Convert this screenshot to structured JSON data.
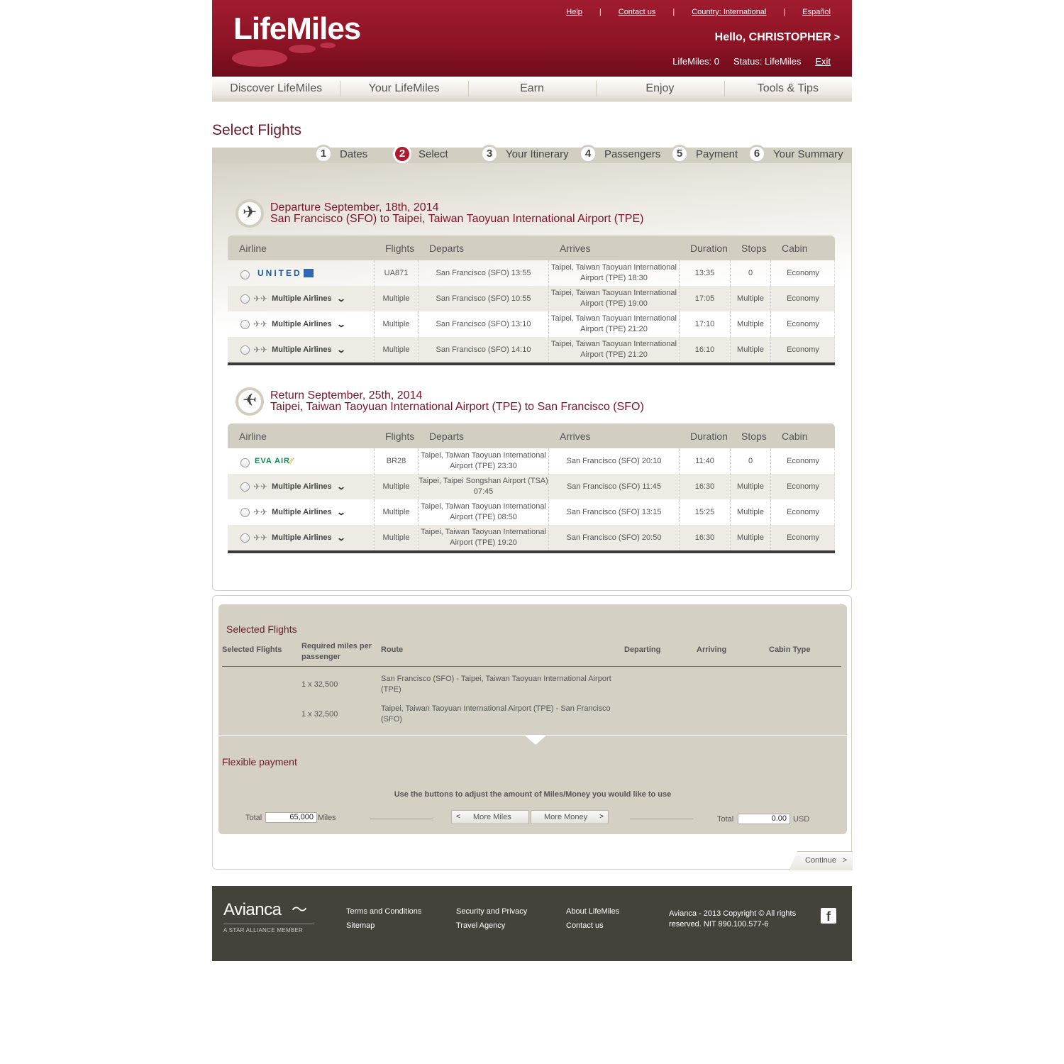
{
  "header": {
    "logo": "LifeMiles",
    "links": {
      "help": "Help",
      "contact": "Contact us",
      "country": "Country: International",
      "language": "Español"
    },
    "greeting": "Hello, CHRISTOPHER",
    "greeting_chevron": ">",
    "lifemiles": "LifeMiles: 0",
    "status": "Status: LifeMiles",
    "exit": "Exit"
  },
  "nav": [
    "Discover LifeMiles",
    "Your LifeMiles",
    "Earn",
    "Enjoy",
    "Tools & Tips"
  ],
  "page_title": "Select Flights",
  "steps": [
    {
      "num": "1",
      "label": "Dates"
    },
    {
      "num": "2",
      "label": "Select"
    },
    {
      "num": "3",
      "label": "Your Itinerary"
    },
    {
      "num": "4",
      "label": "Passengers"
    },
    {
      "num": "5",
      "label": "Payment"
    },
    {
      "num": "6",
      "label": "Your Summary"
    }
  ],
  "columns": {
    "airline": "Airline",
    "flights": "Flights",
    "departs": "Departs",
    "arrives": "Arrives",
    "duration": "Duration",
    "stops": "Stops",
    "cabin": "Cabin"
  },
  "departure": {
    "title": "Departure September, 18th, 2014",
    "route": "San Francisco (SFO) to Taipei, Taiwan Taoyuan International Airport (TPE)",
    "rows": [
      {
        "airline": "UNITED",
        "flight": "UA871",
        "departs": "San Francisco (SFO) 13:55",
        "arrives": "Taipei, Taiwan Taoyuan International Airport (TPE) 18:30",
        "duration": "13:35",
        "stops": "0",
        "cabin": "Economy"
      },
      {
        "airline": "Multiple Airlines",
        "flight": "Multiple",
        "departs": "San Francisco (SFO) 10:55",
        "arrives": "Taipei, Taiwan Taoyuan International Airport (TPE) 19:00",
        "duration": "17:05",
        "stops": "Multiple",
        "cabin": "Economy"
      },
      {
        "airline": "Multiple Airlines",
        "flight": "Multiple",
        "departs": "San Francisco (SFO) 13:10",
        "arrives": "Taipei, Taiwan Taoyuan International Airport (TPE) 21:20",
        "duration": "17:10",
        "stops": "Multiple",
        "cabin": "Economy"
      },
      {
        "airline": "Multiple Airlines",
        "flight": "Multiple",
        "departs": "San Francisco (SFO) 14:10",
        "arrives": "Taipei, Taiwan Taoyuan International Airport (TPE) 21:20",
        "duration": "16:10",
        "stops": "Multiple",
        "cabin": "Economy"
      }
    ]
  },
  "return": {
    "title": "Return September, 25th, 2014",
    "route": "Taipei, Taiwan Taoyuan International Airport (TPE) to San Francisco (SFO)",
    "rows": [
      {
        "airline": "EVA AIR",
        "flight": "BR28",
        "departs": "Taipei, Taiwan Taoyuan International Airport (TPE) 23:30",
        "arrives": "San Francisco (SFO) 20:10",
        "duration": "11:40",
        "stops": "0",
        "cabin": "Economy"
      },
      {
        "airline": "Multiple Airlines",
        "flight": "Multiple",
        "departs": "Taipei, Taipei Songshan Airport (TSA) 07:45",
        "arrives": "San Francisco (SFO) 11:45",
        "duration": "16:30",
        "stops": "Multiple",
        "cabin": "Economy"
      },
      {
        "airline": "Multiple Airlines",
        "flight": "Multiple",
        "departs": "Taipei, Taiwan Taoyuan International Airport (TPE) 08:50",
        "arrives": "San Francisco (SFO) 13:15",
        "duration": "15:25",
        "stops": "Multiple",
        "cabin": "Economy"
      },
      {
        "airline": "Multiple Airlines",
        "flight": "Multiple",
        "departs": "Taipei, Taiwan Taoyuan International Airport (TPE) 19:20",
        "arrives": "San Francisco (SFO) 20:50",
        "duration": "16:30",
        "stops": "Multiple",
        "cabin": "Economy"
      }
    ]
  },
  "selected": {
    "title": "Selected Flights",
    "headers": {
      "flights": "Selected Flights",
      "miles": "Required miles per passenger",
      "route": "Route",
      "departing": "Departing",
      "arriving": "Arriving",
      "cabin": "Cabin Type"
    },
    "rows": [
      {
        "miles": "1 x 32,500",
        "route": "San Francisco (SFO) - Taipei, Taiwan Taoyuan International Airport (TPE)"
      },
      {
        "miles": "1 x 32,500",
        "route": "Taipei, Taiwan Taoyuan International Airport (TPE) - San Francisco (SFO)"
      }
    ]
  },
  "flexible": {
    "title": "Flexible payment",
    "instruction": "Use the buttons to adjust the amount of Miles/Money you would like to use",
    "total_label": "Total",
    "miles_value": "65,000",
    "miles_unit": "Miles",
    "more_miles": "More Miles",
    "more_money": "More Money",
    "money_value": "0.00",
    "money_unit": "USD"
  },
  "continue": "Continue",
  "footer": {
    "brand": "Avianca",
    "star": "A STAR ALLIANCE MEMBER",
    "links": [
      "Terms and Conditions",
      "Sitemap",
      "Security and Privacy",
      "Travel Agency",
      "About LifeMiles",
      "Contact us"
    ],
    "copyright": "Avianca - 2013 Copyright © All rights reserved. NIT 890.100.577-6",
    "social": "f"
  },
  "icons": [
    "plane-icon",
    "radio-icon",
    "multi-airline-icon",
    "chevron-down-icon",
    "facebook-icon"
  ]
}
